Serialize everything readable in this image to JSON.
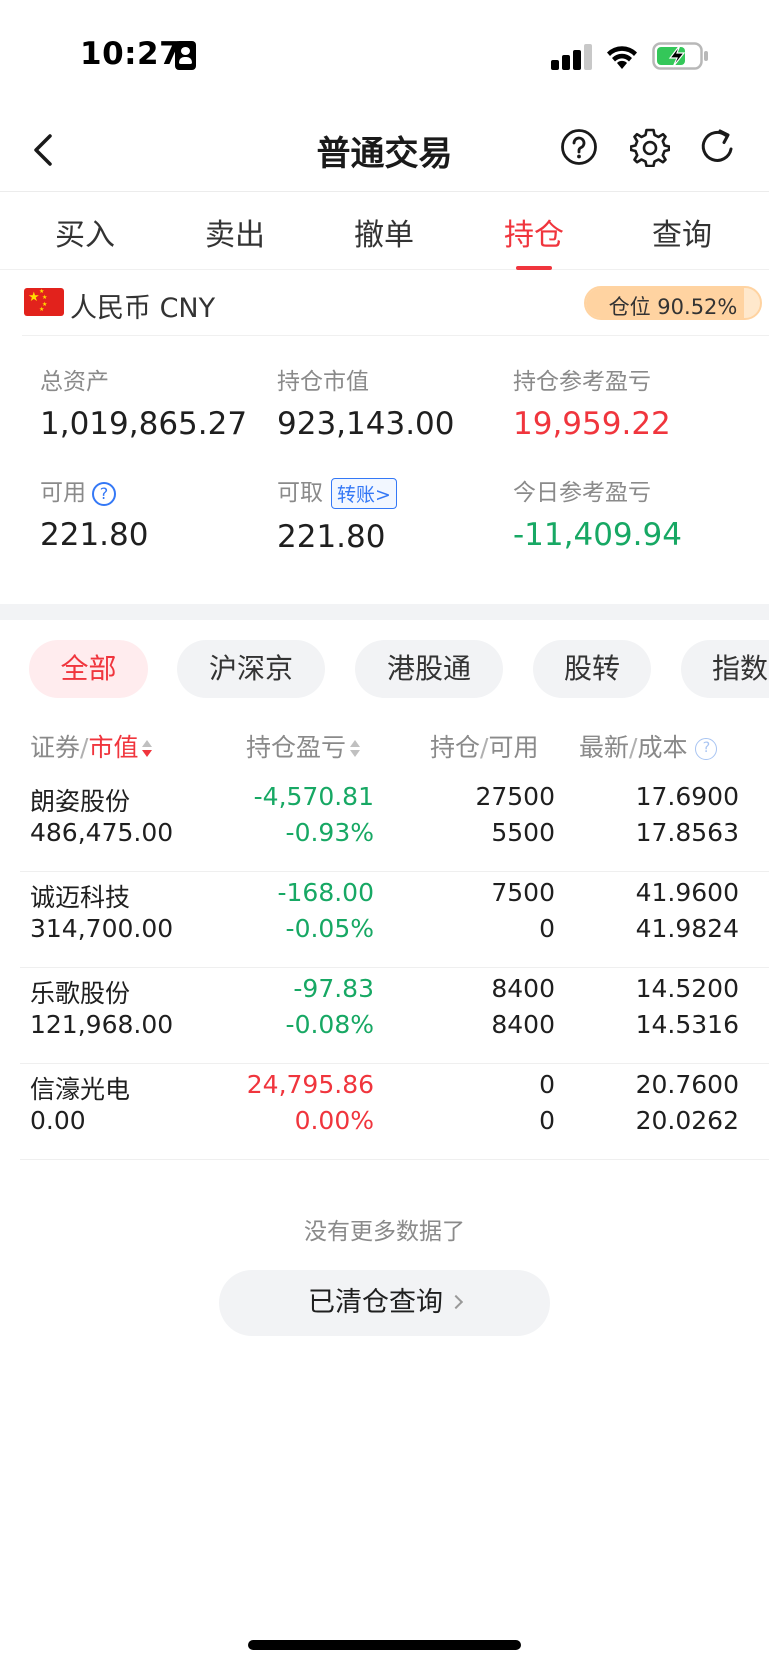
{
  "status_bar": {
    "time": "10:27"
  },
  "navbar": {
    "title": "普通交易"
  },
  "tabs": [
    {
      "label": "买入",
      "active": false
    },
    {
      "label": "卖出",
      "active": false
    },
    {
      "label": "撤单",
      "active": false
    },
    {
      "label": "持仓",
      "active": true
    },
    {
      "label": "查询",
      "active": false
    }
  ],
  "currency": {
    "label": "人民币 CNY",
    "position_label": "仓位 90.52%",
    "position_ratio": 0.9052
  },
  "summary": {
    "total_assets_label": "总资产",
    "total_assets": "1,019,865.27",
    "market_value_label": "持仓市值",
    "market_value": "923,143.00",
    "position_pnl_label": "持仓参考盈亏",
    "position_pnl": "19,959.22",
    "available_label": "可用",
    "available": "221.80",
    "withdrawable_label": "可取",
    "transfer_label": "转账>",
    "withdrawable": "221.80",
    "today_pnl_label": "今日参考盈亏",
    "today_pnl": "-11,409.94"
  },
  "filters": [
    {
      "label": "全部",
      "active": true
    },
    {
      "label": "沪深京",
      "active": false
    },
    {
      "label": "港股通",
      "active": false
    },
    {
      "label": "股转",
      "active": false
    },
    {
      "label": "指数",
      "active": false
    }
  ],
  "table_header": {
    "security": "证券",
    "sep": "/",
    "market_value": "市值",
    "pnl": "持仓盈亏",
    "holding": "持仓",
    "available": "可用",
    "latest": "最新",
    "cost": "成本"
  },
  "holdings": [
    {
      "name": "朗姿股份",
      "market_value": "486,475.00",
      "pnl": "-4,570.81",
      "pnl_pct": "-0.93%",
      "pnl_color": "green",
      "holding": "27500",
      "available": "5500",
      "latest": "17.6900",
      "cost": "17.8563"
    },
    {
      "name": "诚迈科技",
      "market_value": "314,700.00",
      "pnl": "-168.00",
      "pnl_pct": "-0.05%",
      "pnl_color": "green",
      "holding": "7500",
      "available": "0",
      "latest": "41.9600",
      "cost": "41.9824"
    },
    {
      "name": "乐歌股份",
      "market_value": "121,968.00",
      "pnl": "-97.83",
      "pnl_pct": "-0.08%",
      "pnl_color": "green",
      "holding": "8400",
      "available": "8400",
      "latest": "14.5200",
      "cost": "14.5316"
    },
    {
      "name": "信濠光电",
      "market_value": "0.00",
      "pnl": "24,795.86",
      "pnl_pct": "0.00%",
      "pnl_color": "red",
      "holding": "0",
      "available": "0",
      "latest": "20.7600",
      "cost": "20.0262"
    }
  ],
  "footer": {
    "no_more": "没有更多数据了",
    "cleared_query": "已清仓查询"
  },
  "colors": {
    "accent_red": "#f0353d",
    "gain_red": "#f0353d",
    "loss_green": "#17a864",
    "link_blue": "#3478f6"
  }
}
